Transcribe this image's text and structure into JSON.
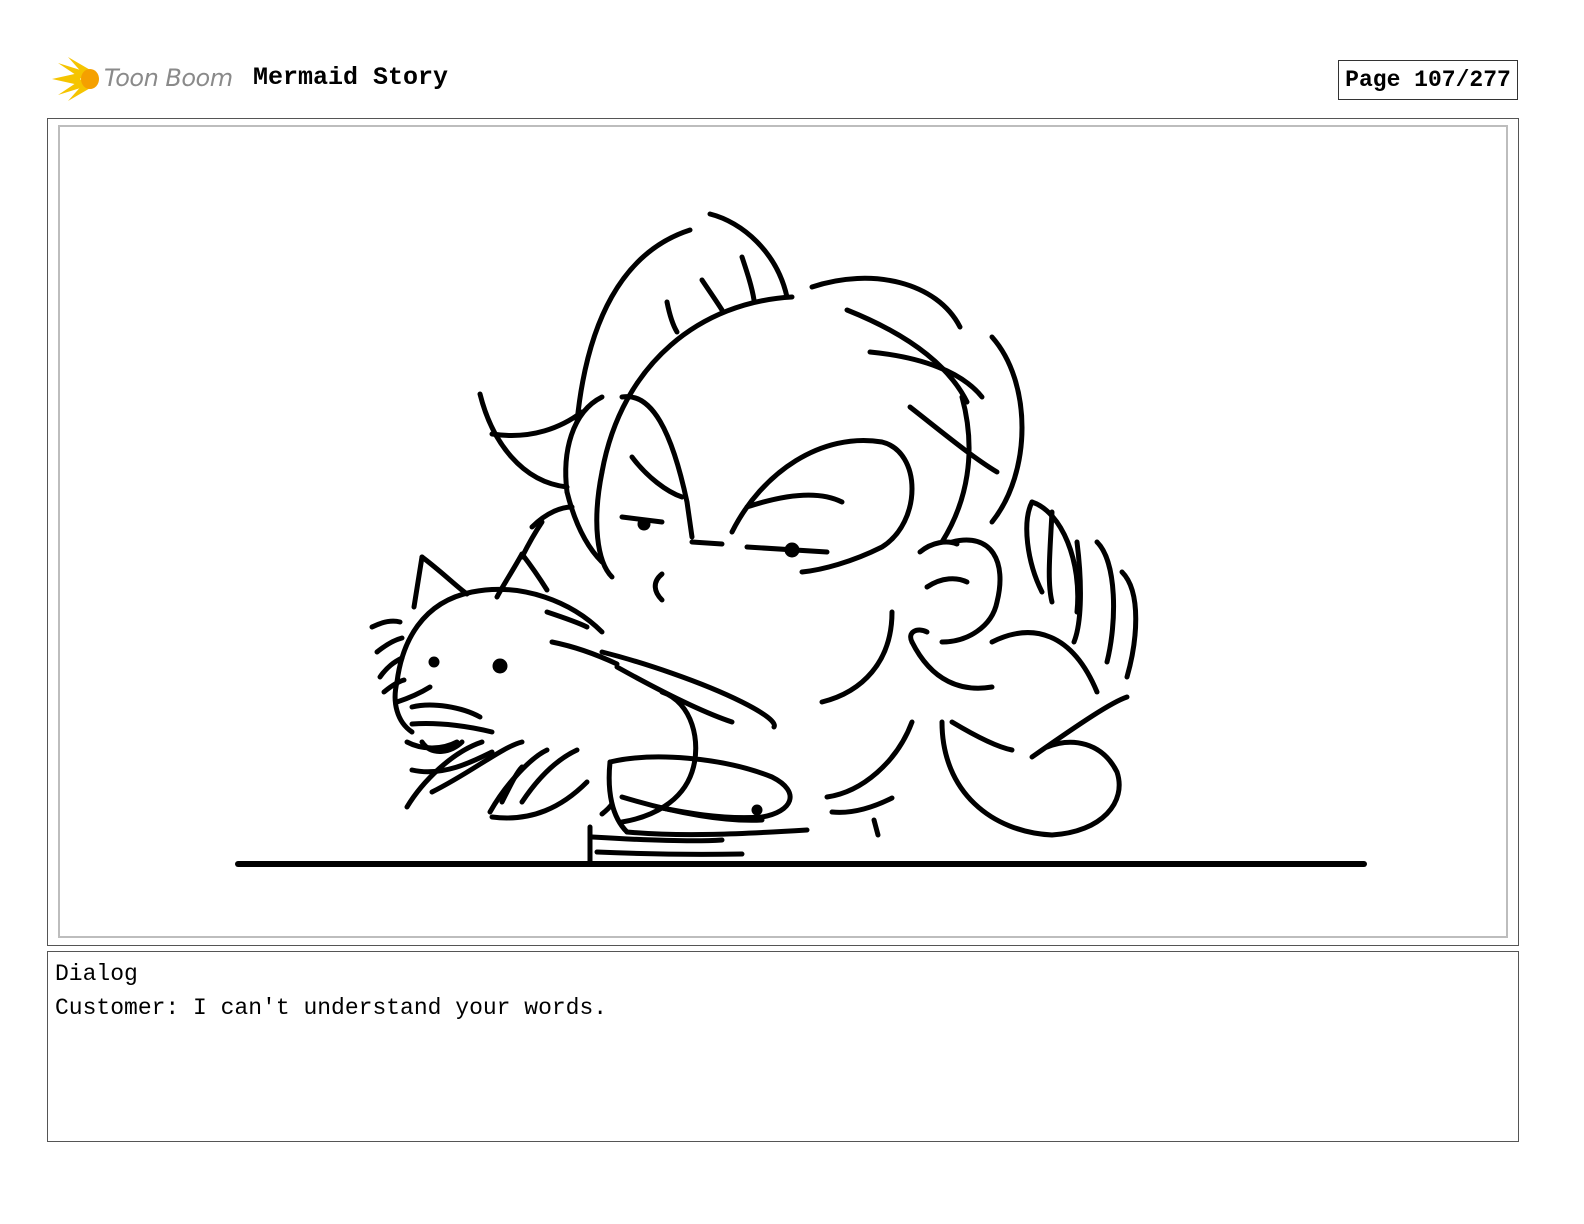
{
  "header": {
    "logo_text": "Toon Boom",
    "project_title": "Mermaid Story",
    "page_label": "Page 107/277"
  },
  "panel": {
    "icon": "storyboard-sketch"
  },
  "dialog": {
    "heading": "Dialog",
    "text": "Customer: I can't understand your words."
  },
  "colors": {
    "logo_star": "#f5c400",
    "logo_text": "#8a8a8a",
    "sketch_ink": "#000000"
  }
}
